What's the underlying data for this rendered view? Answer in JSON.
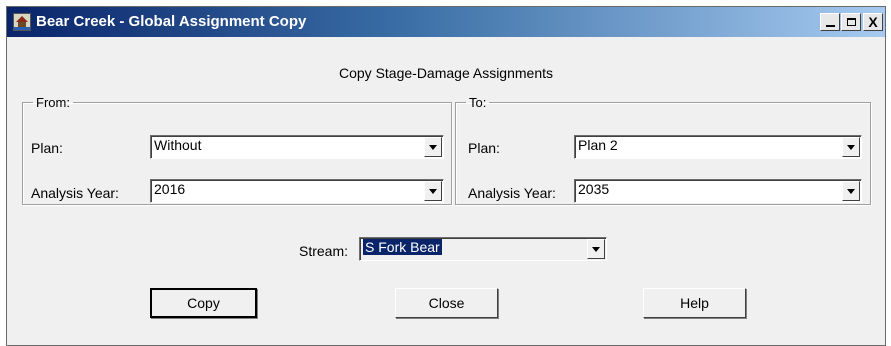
{
  "window": {
    "title": "Bear Creek - Global Assignment Copy",
    "controls": {
      "minimize": "_",
      "maximize": "□",
      "close": "X"
    }
  },
  "heading": "Copy Stage-Damage Assignments",
  "from": {
    "legend": "From:",
    "plan_label": "Plan:",
    "plan_value": "Without",
    "year_label": "Analysis Year:",
    "year_value": "2016"
  },
  "to": {
    "legend": "To:",
    "plan_label": "Plan:",
    "plan_value": "Plan 2",
    "year_label": "Analysis Year:",
    "year_value": "2035"
  },
  "stream": {
    "label": "Stream:",
    "value": "S Fork Bear"
  },
  "buttons": {
    "copy": "Copy",
    "close": "Close",
    "help": "Help"
  },
  "icons": [
    "app-icon",
    "minimize-icon",
    "maximize-icon",
    "close-icon",
    "dropdown-arrow-icon"
  ],
  "colors": {
    "titlebar_start": "#0a246a",
    "titlebar_end": "#a6caf0",
    "dialog_bg": "#f0f0f0",
    "selection": "#0a246a"
  }
}
